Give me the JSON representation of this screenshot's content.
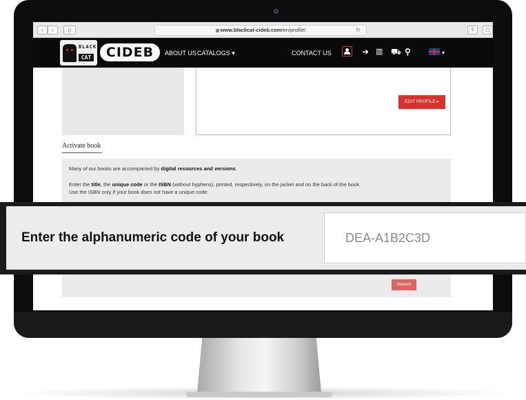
{
  "browser": {
    "url_host": "www.blackcat-cideb.com",
    "url_path": "/en/profile/"
  },
  "header": {
    "logo_top": "BLACK",
    "logo_bottom": "CAT",
    "brand": "CIDEB",
    "nav": {
      "about": "ABOUT US",
      "catalogs": "CATALOGS",
      "contact": "CONTACT US"
    }
  },
  "profile": {
    "edit_button": "EDIT PROFILE"
  },
  "activate": {
    "title": "Activate book",
    "line1_pre": "Many of our books are accompanied by ",
    "line1_bold": "digital resources and versions",
    "line1_post": ".",
    "line2_a": "Enter the ",
    "line2_b": "title",
    "line2_c": ", the ",
    "line2_d": "unique code",
    "line2_e": " or the ",
    "line2_f": "ISBN",
    "line2_g": " (without hyphens), printed, respectively, on the jacket and on the back of the book.",
    "line3": "Use the ISBN only if your book does not have a unique code.",
    "search_button": "Search"
  },
  "callout": {
    "label": "Enter the alphanumeric code of your book",
    "input_placeholder": "DEA-A1B2C3D"
  },
  "colors": {
    "accent": "#d8322d",
    "header_bg": "#0a0a0a",
    "content_bg": "#ebebeb"
  }
}
